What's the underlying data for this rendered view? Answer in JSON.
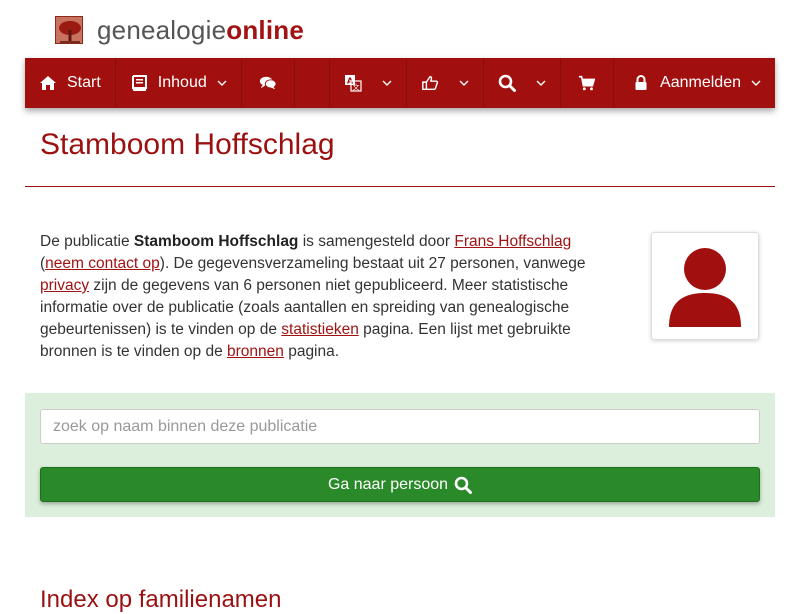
{
  "header": {
    "site_name_part1": "genealogie",
    "site_name_part2": "online"
  },
  "nav": {
    "start_label": "Start",
    "inhoud_label": "Inhoud",
    "login_label": "Aanmelden",
    "icons": [
      "home-icon",
      "book-icon",
      "comments-icon",
      "translate-icon",
      "thumbs-up-icon",
      "search-icon",
      "shopping-cart-icon",
      "lock-icon"
    ]
  },
  "page": {
    "title": "Stamboom Hoffschlag"
  },
  "intro": {
    "t1": "De publicatie ",
    "publication_name": "Stamboom Hoffschlag",
    "t2": " is samengesteld door ",
    "author_link": "Frans Hoffschlag",
    "t3": " (",
    "contact_link": "neem contact op",
    "t4": "). De gegevensverzameling bestaat uit 27 personen, vanwege ",
    "privacy_link": "privacy",
    "t5": " zijn de gegevens van 6 personen niet gepubliceerd. Meer statistische informatie over de publicatie (zoals aantallen en spreiding van genealogische gebeurtenissen) is te vinden op de ",
    "stats_link": "statistieken",
    "t6": " pagina. Een lijst met gebruikte bronnen is te vinden op de ",
    "sources_link": "bronnen",
    "t7": " pagina."
  },
  "search": {
    "placeholder": "zoek op naam binnen deze publicatie",
    "button_label": "Ga naar persoon"
  },
  "sections": {
    "family_index_heading": "Index op familienamen"
  },
  "colors": {
    "brand_red": "#a20f0f",
    "panel_green": "#dcefdc",
    "button_green": "#2a8a2a"
  }
}
